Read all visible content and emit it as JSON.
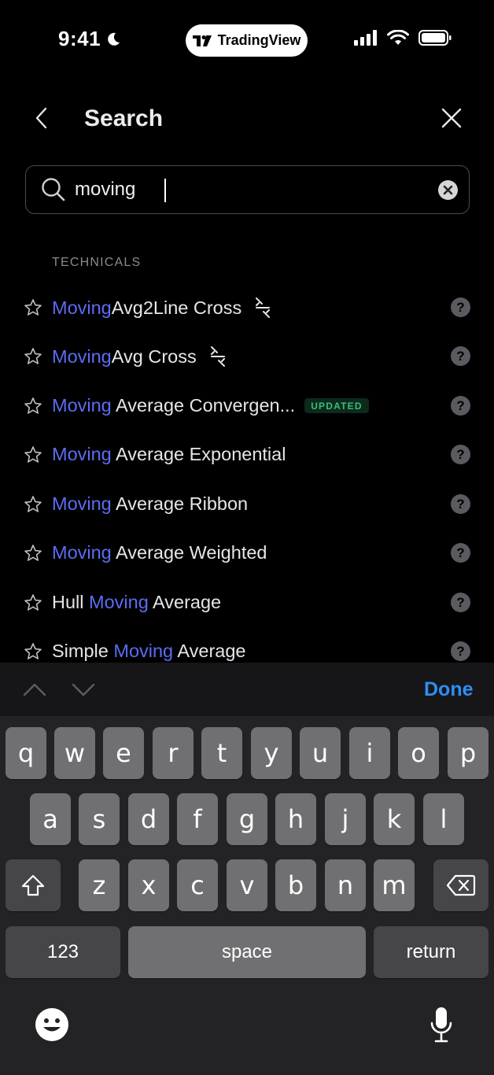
{
  "status_bar": {
    "time": "9:41",
    "app_pill": "TradingView"
  },
  "header": {
    "title": "Search"
  },
  "search": {
    "value": "moving"
  },
  "section": {
    "label": "TECHNICALS"
  },
  "results": [
    {
      "hl": "Moving",
      "rest": "Avg2Line Cross",
      "pre": ""
    },
    {
      "hl": "Moving",
      "rest": "Avg Cross",
      "pre": ""
    },
    {
      "hl": "Moving",
      "rest": " Average Convergen...",
      "pre": "",
      "badge": "UPDATED"
    },
    {
      "hl": "Moving",
      "rest": " Average Exponential",
      "pre": ""
    },
    {
      "hl": "Moving",
      "rest": " Average Ribbon",
      "pre": ""
    },
    {
      "hl": "Moving",
      "rest": " Average Weighted",
      "pre": ""
    },
    {
      "pre": "Hull ",
      "hl": "Moving",
      "rest": " Average"
    },
    {
      "pre": "Simple ",
      "hl": "Moving",
      "rest": " Average"
    }
  ],
  "help_glyph": "?",
  "accessory": {
    "done_label": "Done"
  },
  "keyboard": {
    "row1": [
      "q",
      "w",
      "e",
      "r",
      "t",
      "y",
      "u",
      "i",
      "o",
      "p"
    ],
    "row2": [
      "a",
      "s",
      "d",
      "f",
      "g",
      "h",
      "j",
      "k",
      "l"
    ],
    "row3": [
      "z",
      "x",
      "c",
      "v",
      "b",
      "n",
      "m"
    ],
    "numbers_label": "123",
    "space_label": "space",
    "return_label": "return"
  },
  "colors": {
    "highlight": "#5b6cf0",
    "done": "#2f8ef5",
    "badge_text": "#36c07a"
  },
  "icons": [
    "moon-icon",
    "tradingview-logo-icon",
    "signal-icon",
    "wifi-icon",
    "battery-icon",
    "back-chevron-icon",
    "close-icon",
    "search-icon",
    "clear-icon",
    "star-icon",
    "sparkle-icon",
    "help-icon",
    "chevron-up-icon",
    "chevron-down-icon",
    "shift-icon",
    "delete-icon",
    "emoji-icon",
    "mic-icon"
  ]
}
